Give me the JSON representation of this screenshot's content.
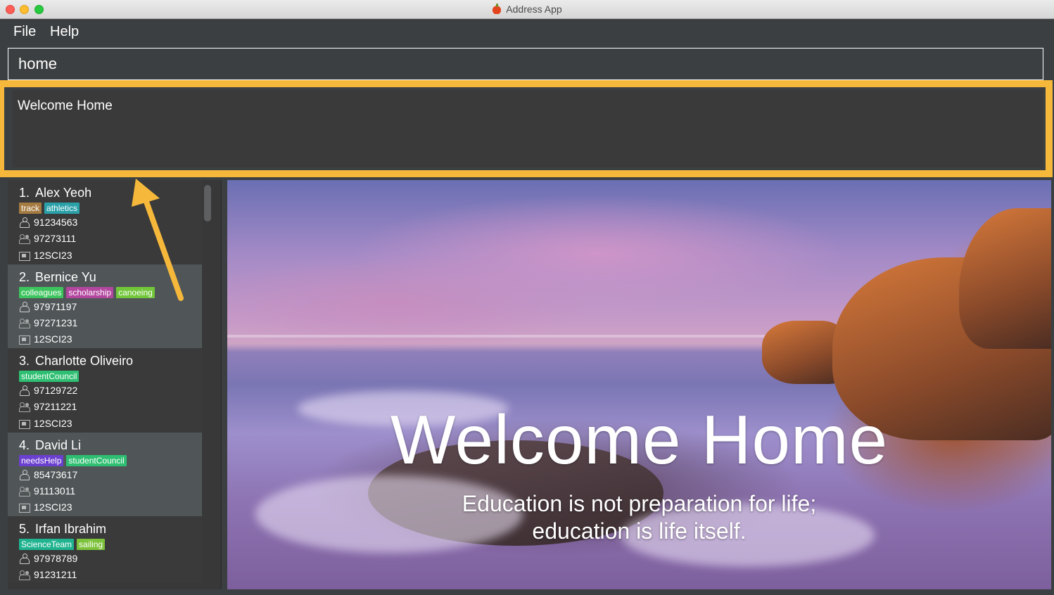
{
  "window": {
    "title": "Address App"
  },
  "menu": {
    "items": [
      "File",
      "Help"
    ]
  },
  "command_box": {
    "value": "home"
  },
  "result_display": {
    "text": "Welcome Home"
  },
  "persons": [
    {
      "index": "1.",
      "name": "Alex Yeoh",
      "tags": [
        {
          "label": "track",
          "color": "#a57b41"
        },
        {
          "label": "athletics",
          "color": "#2aa0a8"
        }
      ],
      "phone": "91234563",
      "home_phone": "97273111",
      "class": "12SCI23"
    },
    {
      "index": "2.",
      "name": "Bernice Yu",
      "tags": [
        {
          "label": "colleagues",
          "color": "#3ec45e"
        },
        {
          "label": "scholarship",
          "color": "#b3479f"
        },
        {
          "label": "canoeing",
          "color": "#72c63a"
        }
      ],
      "phone": "97971197",
      "home_phone": "97271231",
      "class": "12SCI23"
    },
    {
      "index": "3.",
      "name": "Charlotte Oliveiro",
      "tags": [
        {
          "label": "studentCouncil",
          "color": "#2fbf72"
        }
      ],
      "phone": "97129722",
      "home_phone": "97211221",
      "class": "12SCI23"
    },
    {
      "index": "4.",
      "name": "David Li",
      "tags": [
        {
          "label": "needsHelp",
          "color": "#6b3fcf"
        },
        {
          "label": "studentCouncil",
          "color": "#2fbf72"
        }
      ],
      "phone": "85473617",
      "home_phone": "91113011",
      "class": "12SCI23"
    },
    {
      "index": "5.",
      "name": "Irfan Ibrahim",
      "tags": [
        {
          "label": "ScienceTeam",
          "color": "#1fb38f"
        },
        {
          "label": "sailing",
          "color": "#7cc23a"
        }
      ],
      "phone": "97978789",
      "home_phone": "91231211",
      "class": ""
    }
  ],
  "welcome": {
    "title": "Welcome Home",
    "quote_line1": "Education is not preparation for life;",
    "quote_line2": "education is life itself."
  },
  "icons": {
    "phone": "person-icon",
    "home_phone": "family-icon",
    "class": "classroom-icon"
  },
  "colors": {
    "accent_highlight": "#f6b83b",
    "panel_bg": "#3c3f41",
    "alt_card_bg": "#505658"
  }
}
